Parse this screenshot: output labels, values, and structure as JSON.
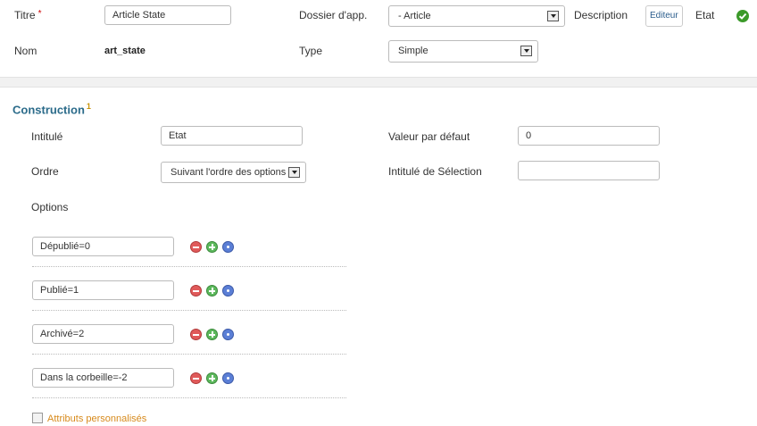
{
  "header": {
    "titre_label": "Titre",
    "required_mark": "*",
    "titre_value": "Article State",
    "dossier_label": "Dossier d'app.",
    "dossier_value": "- Article",
    "description_label": "Description",
    "editeur_button": "Editeur",
    "etat_label": "Etat",
    "etat_status": "check-icon",
    "nom_label": "Nom",
    "nom_value": "art_state",
    "type_label": "Type",
    "type_value": "Simple"
  },
  "construction": {
    "title": "Construction",
    "title_sup": "1",
    "intitule_label": "Intitulé",
    "intitule_value": "Etat",
    "valeur_label": "Valeur par défaut",
    "valeur_value": "0",
    "ordre_label": "Ordre",
    "ordre_value": "Suivant l'ordre des options",
    "intitule_selection_label": "Intitulé de Sélection",
    "intitule_selection_value": "",
    "options_label": "Options",
    "options": [
      {
        "value": "Dépublié=0"
      },
      {
        "value": "Publié=1"
      },
      {
        "value": "Archivé=2"
      },
      {
        "value": "Dans la corbeille=-2"
      }
    ],
    "attributs_label": "Attributs personnalisés"
  },
  "colors": {
    "accent": "#2b6b8a",
    "required": "#cc0000",
    "link_orange": "#d78a1c",
    "status_ok": "#3c9a2a"
  }
}
